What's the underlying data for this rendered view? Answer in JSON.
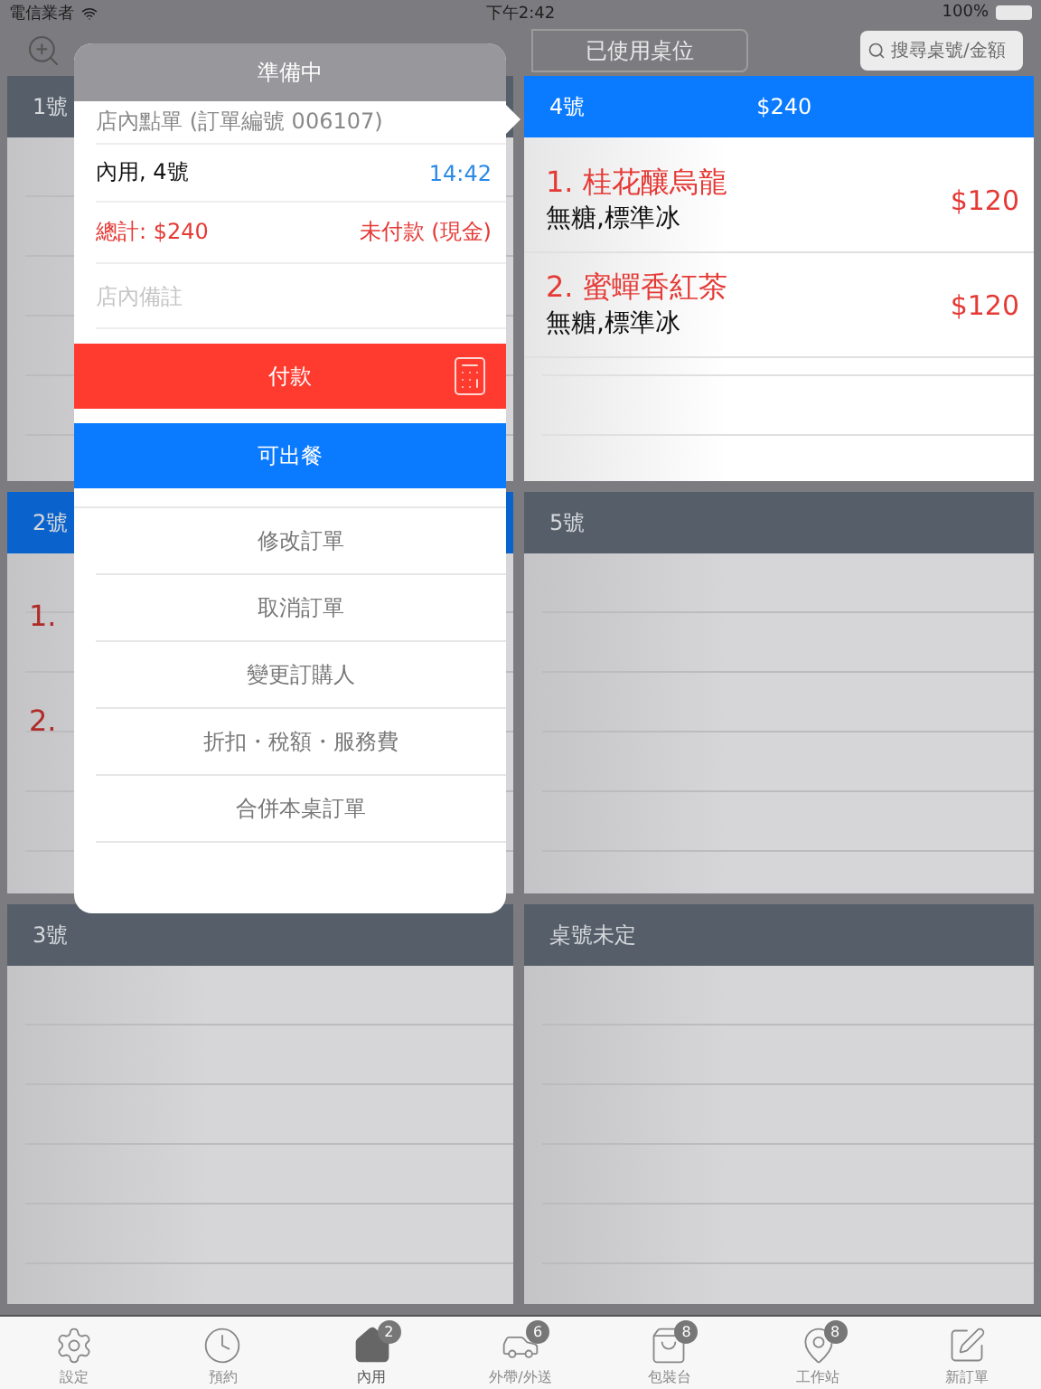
{
  "status_bar": {
    "carrier": "電信業者",
    "time": "下午2:42",
    "battery": "100%"
  },
  "toolbar": {
    "segment": "已使用桌位",
    "search": {
      "placeholder": "搜尋桌號/金額"
    }
  },
  "tables": [
    {
      "name": "1號",
      "occupied": false,
      "focused": false
    },
    {
      "name": "4號",
      "occupied": true,
      "focused": true,
      "total": "$240",
      "items": [
        {
          "name": "1. 桂花釀烏龍",
          "note": "無糖,標準冰",
          "price": "$120"
        },
        {
          "name": "2. 蜜蟬香紅茶",
          "note": "無糖,標準冰",
          "price": "$120"
        }
      ]
    },
    {
      "name": "2號",
      "occupied": true,
      "focused": false,
      "items": [
        {
          "name": "1."
        },
        {
          "name": "2."
        }
      ]
    },
    {
      "name": "5號",
      "occupied": false,
      "focused": false
    },
    {
      "name": "3號",
      "occupied": false,
      "focused": false
    },
    {
      "name": "桌號未定",
      "occupied": false,
      "focused": false
    }
  ],
  "popover": {
    "title": "準備中",
    "order_info": "店內點單 (訂單編號 006107)",
    "dine": "內用, 4號",
    "time": "14:42",
    "total": "總計: $240",
    "payment": "未付款 (現金)",
    "note": {
      "placeholder": "店內備註"
    },
    "pay_button": "付款",
    "ready_button": "可出餐",
    "actions": [
      "修改訂單",
      "取消訂單",
      "變更訂購人",
      "折扣・稅額・服務費",
      "合併本桌訂單"
    ]
  },
  "tab_bar": [
    {
      "kind": "settings",
      "label": "設定",
      "selected": false
    },
    {
      "kind": "clock",
      "label": "預約",
      "selected": false
    },
    {
      "kind": "home",
      "label": "內用",
      "badge": "2",
      "selected": true
    },
    {
      "kind": "car",
      "label": "外帶/外送",
      "badge": "6",
      "selected": false
    },
    {
      "kind": "bag",
      "label": "包裝台",
      "badge": "8",
      "selected": false
    },
    {
      "kind": "pin",
      "label": "工作站",
      "badge": "8",
      "selected": false
    },
    {
      "kind": "edit",
      "label": "新訂單",
      "selected": false
    }
  ]
}
